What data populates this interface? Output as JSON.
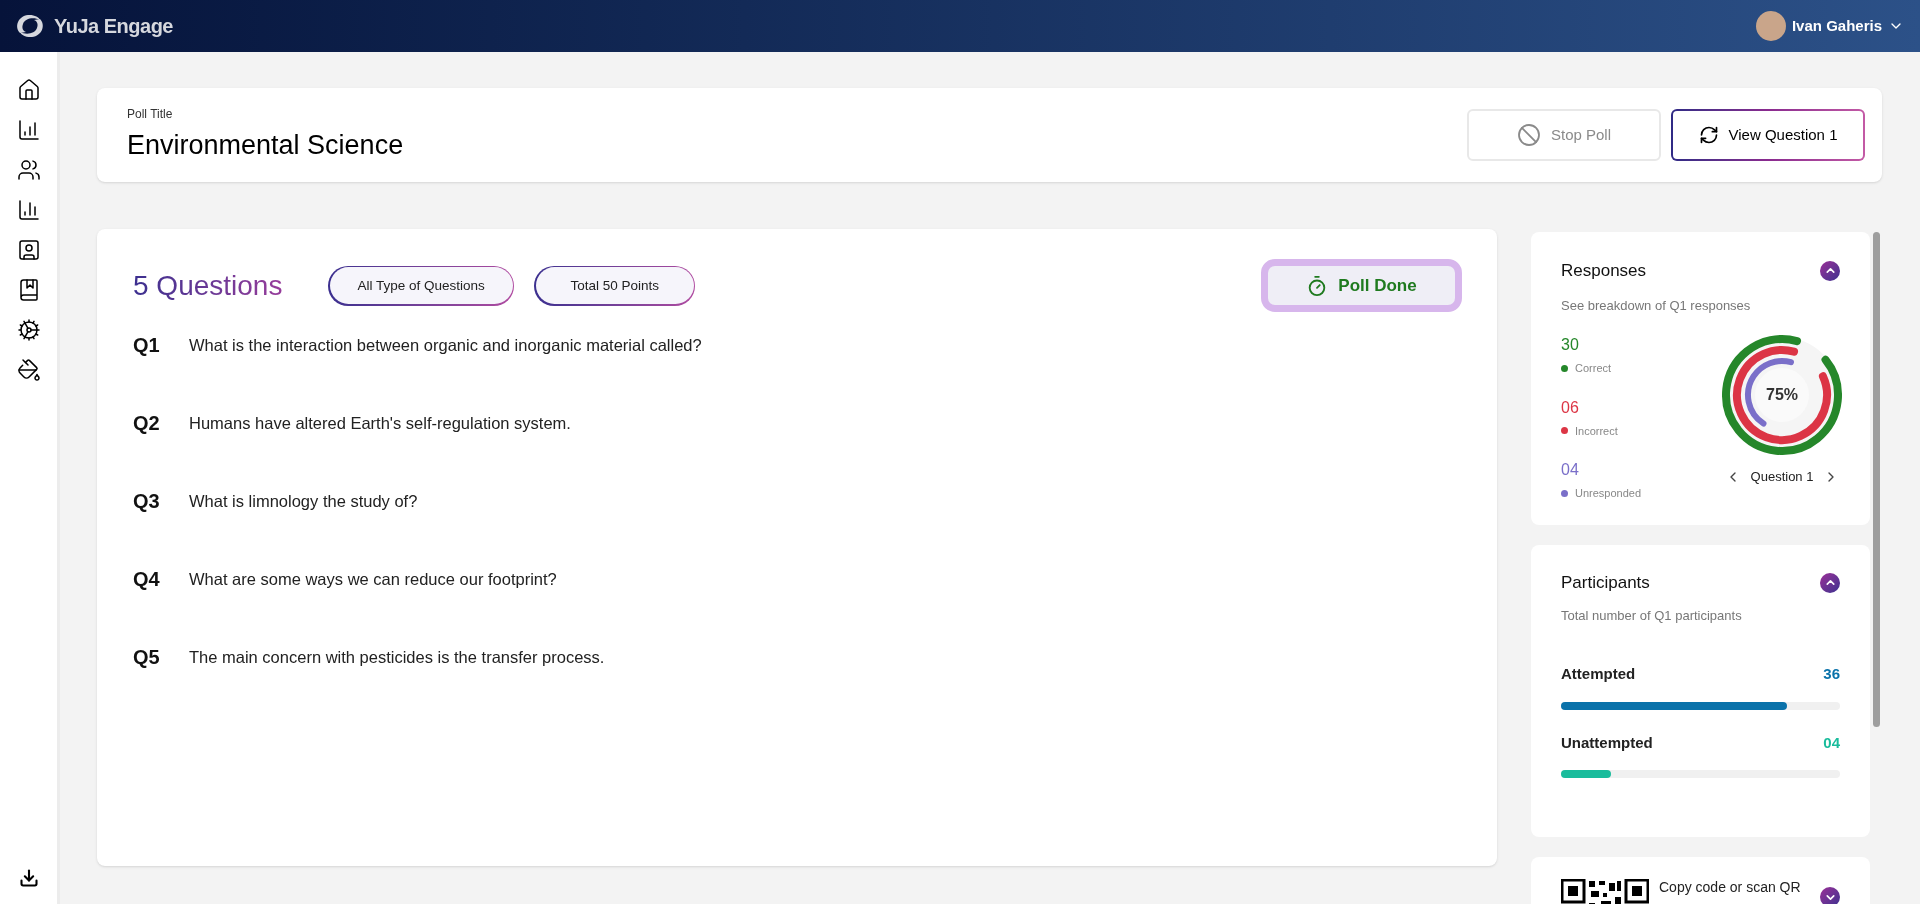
{
  "app": {
    "name": "YuJa Engage"
  },
  "user": {
    "name": "Ivan Gaheris"
  },
  "poll": {
    "title_label": "Poll Title",
    "title": "Environmental Science",
    "buttons": [
      {
        "label": "Stop Poll",
        "kind": "stop",
        "disabled": true
      },
      {
        "label": "View Question 1",
        "kind": "view",
        "disabled": false
      }
    ]
  },
  "questions": {
    "heading": "5 Questions",
    "tags": [
      "All Type of Questions",
      "Total 50 Points"
    ],
    "status": "Poll Done",
    "items": [
      {
        "number": "Q1",
        "text": "What is the interaction between organic and inorganic material called?"
      },
      {
        "number": "Q2",
        "text": "Humans have altered Earth's self-regulation system."
      },
      {
        "number": "Q3",
        "text": "What is limnology the study of?"
      },
      {
        "number": "Q4",
        "text": "What are some ways we can reduce our footprint?"
      },
      {
        "number": "Q5",
        "text": "The main concern with pesticides is the transfer process."
      }
    ]
  },
  "responses": {
    "title": "Responses",
    "subtitle": "See breakdown of Q1 responses",
    "expanded": true,
    "center": "75%",
    "nav_label": "Question 1",
    "items": [
      {
        "value": "30",
        "label": "Correct",
        "color": "#25872a"
      },
      {
        "value": "06",
        "label": "Incorrect",
        "color": "#dc3545"
      },
      {
        "value": "04",
        "label": "Unresponded",
        "color": "#7a6fc9"
      }
    ]
  },
  "participants": {
    "title": "Participants",
    "subtitle": "Total number of Q1 participants",
    "expanded": true,
    "items": [
      {
        "label": "Attempted",
        "value": "36",
        "color": "#0a72aa",
        "level": 0.81
      },
      {
        "label": "Unattempted",
        "value": "04",
        "color": "#1abc9c",
        "level": 0.18
      }
    ]
  },
  "qr": {
    "text": "Copy code or scan QR",
    "expanded": false
  }
}
